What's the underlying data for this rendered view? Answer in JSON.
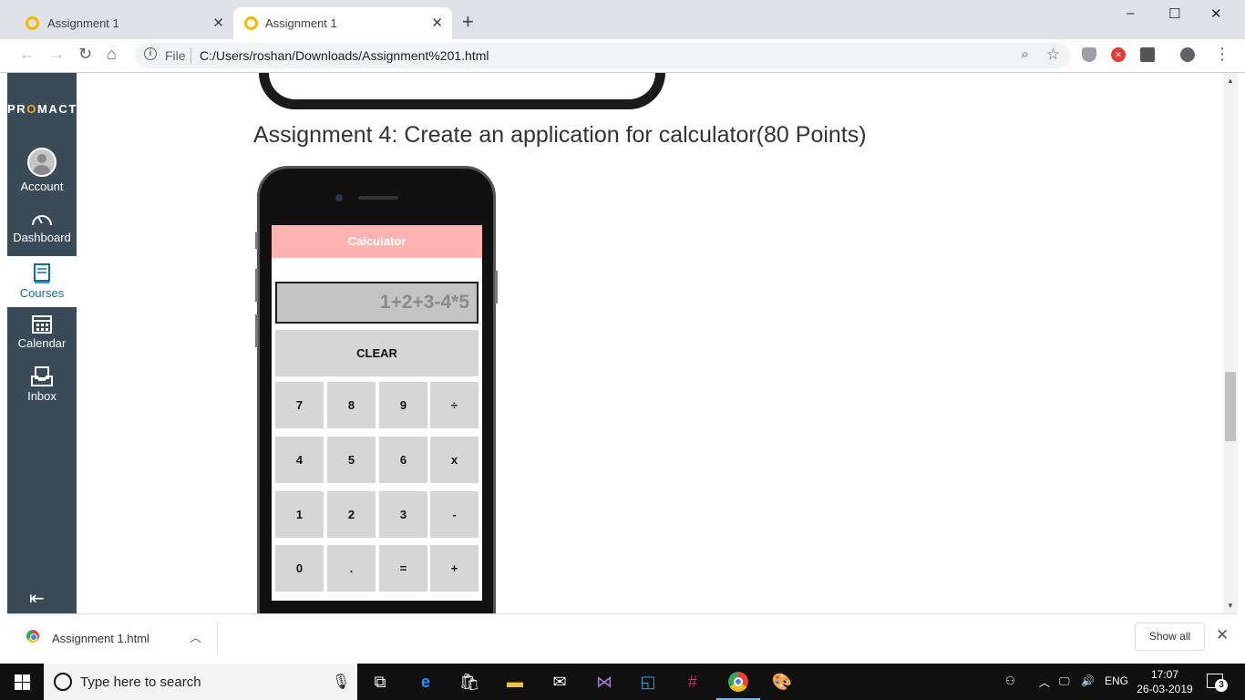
{
  "browser": {
    "tabs": [
      {
        "title": "Assignment 1",
        "active": false
      },
      {
        "title": "Assignment 1",
        "active": true
      }
    ],
    "new_tab_icon": "plus-icon",
    "window_controls": {
      "minimize": "–",
      "maximize": "☐",
      "close": "✕"
    },
    "omnibox": {
      "scheme_label": "File",
      "url": "C:/Users/roshan/Downloads/Assignment%201.html"
    }
  },
  "sidebar": {
    "logo_prefix": "PR",
    "logo_o": "O",
    "logo_suffix": "MACT",
    "items": [
      {
        "label": "Account",
        "icon": "avatar-icon",
        "active": false
      },
      {
        "label": "Dashboard",
        "icon": "speedometer-icon",
        "active": false
      },
      {
        "label": "Courses",
        "icon": "book-icon",
        "active": true
      },
      {
        "label": "Calendar",
        "icon": "calendar-icon",
        "active": false
      },
      {
        "label": "Inbox",
        "icon": "inbox-icon",
        "active": false
      }
    ],
    "collapse_icon": "collapse-left-icon",
    "colors": {
      "background": "#394b58",
      "active_text": "#0770a3"
    }
  },
  "content": {
    "heading": "Assignment 4: Create an application for calculator(80 Points)",
    "calculator": {
      "title": "Calculator",
      "display": "1+2+3-4*5",
      "clear_label": "CLEAR",
      "keys": [
        [
          "7",
          "8",
          "9",
          "÷"
        ],
        [
          "4",
          "5",
          "6",
          "x"
        ],
        [
          "1",
          "2",
          "3",
          "-"
        ],
        [
          "0",
          ".",
          "=",
          "+"
        ]
      ],
      "colors": {
        "header": "#ffb3b0",
        "key": "#d6d6d6",
        "display": "#c4c4c4"
      }
    }
  },
  "downloads": {
    "file_name": "Assignment 1.html",
    "show_all_label": "Show all"
  },
  "taskbar": {
    "search_placeholder": "Type here to search",
    "language": "ENG",
    "time": "17:07",
    "date": "26-03-2019",
    "notification_count": "3"
  }
}
